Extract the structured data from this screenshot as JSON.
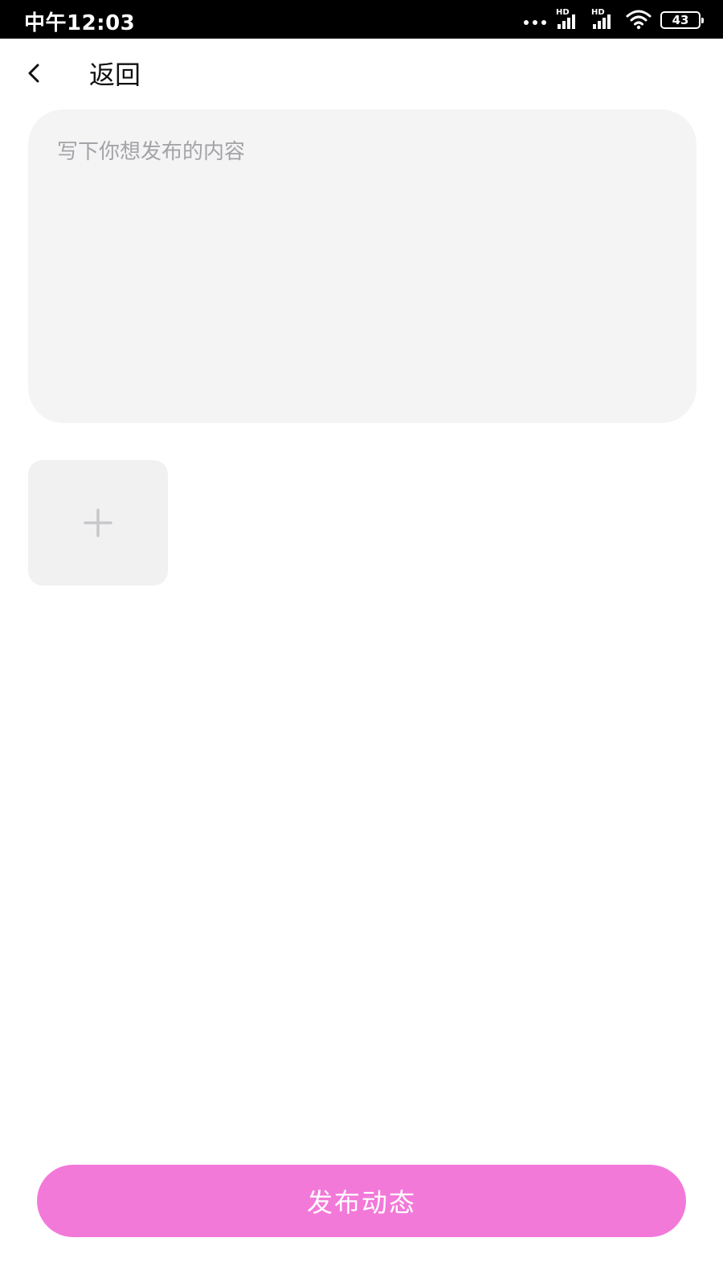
{
  "status_bar": {
    "time": "中午12:03",
    "signal_1_label": "HD",
    "signal_2_label": "HD",
    "battery_level": "43",
    "icons": [
      "more-dots-icon",
      "signal-icon",
      "signal-icon",
      "wifi-icon",
      "battery-icon"
    ]
  },
  "header": {
    "back_label": "返回",
    "back_icon": "chevron-left-icon"
  },
  "editor": {
    "placeholder": "写下你想发布的内容",
    "value": ""
  },
  "media": {
    "add_icon": "plus-icon"
  },
  "actions": {
    "publish_label": "发布动态"
  },
  "colors": {
    "accent": "#f379d9",
    "input_background": "#f4f4f5",
    "placeholder_text": "#a3a3a8",
    "add_tile_background": "#f1f1f2",
    "add_icon": "#c8c8cc"
  }
}
